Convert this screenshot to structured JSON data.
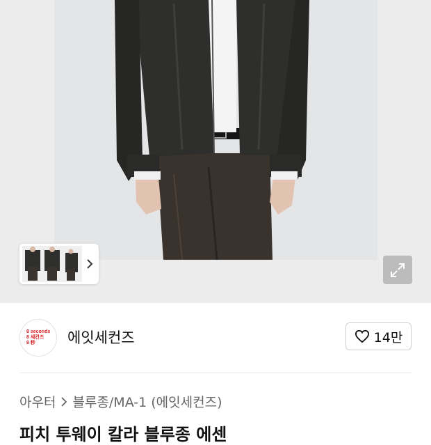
{
  "hero": {
    "photo_alt": "model wearing dark zip-up jacket",
    "expand_icon": "expand-icon"
  },
  "thumbnails": {
    "chevron_icon": "chevron-right-icon"
  },
  "store": {
    "logo_lines": [
      "8 seconds",
      "8 세컨즈",
      "8 秒"
    ],
    "name": "에잇세컨즈"
  },
  "like": {
    "icon": "heart-icon",
    "count": "14만"
  },
  "breadcrumb": {
    "category": "아우터",
    "subcategory": "블루종/MA-1 (에잇세컨즈)"
  },
  "product": {
    "title": "피치 투웨이 칼라 블루종 에센"
  },
  "colors": {
    "brand_red": "#e0252b",
    "text": "#111111",
    "muted": "#666666"
  }
}
